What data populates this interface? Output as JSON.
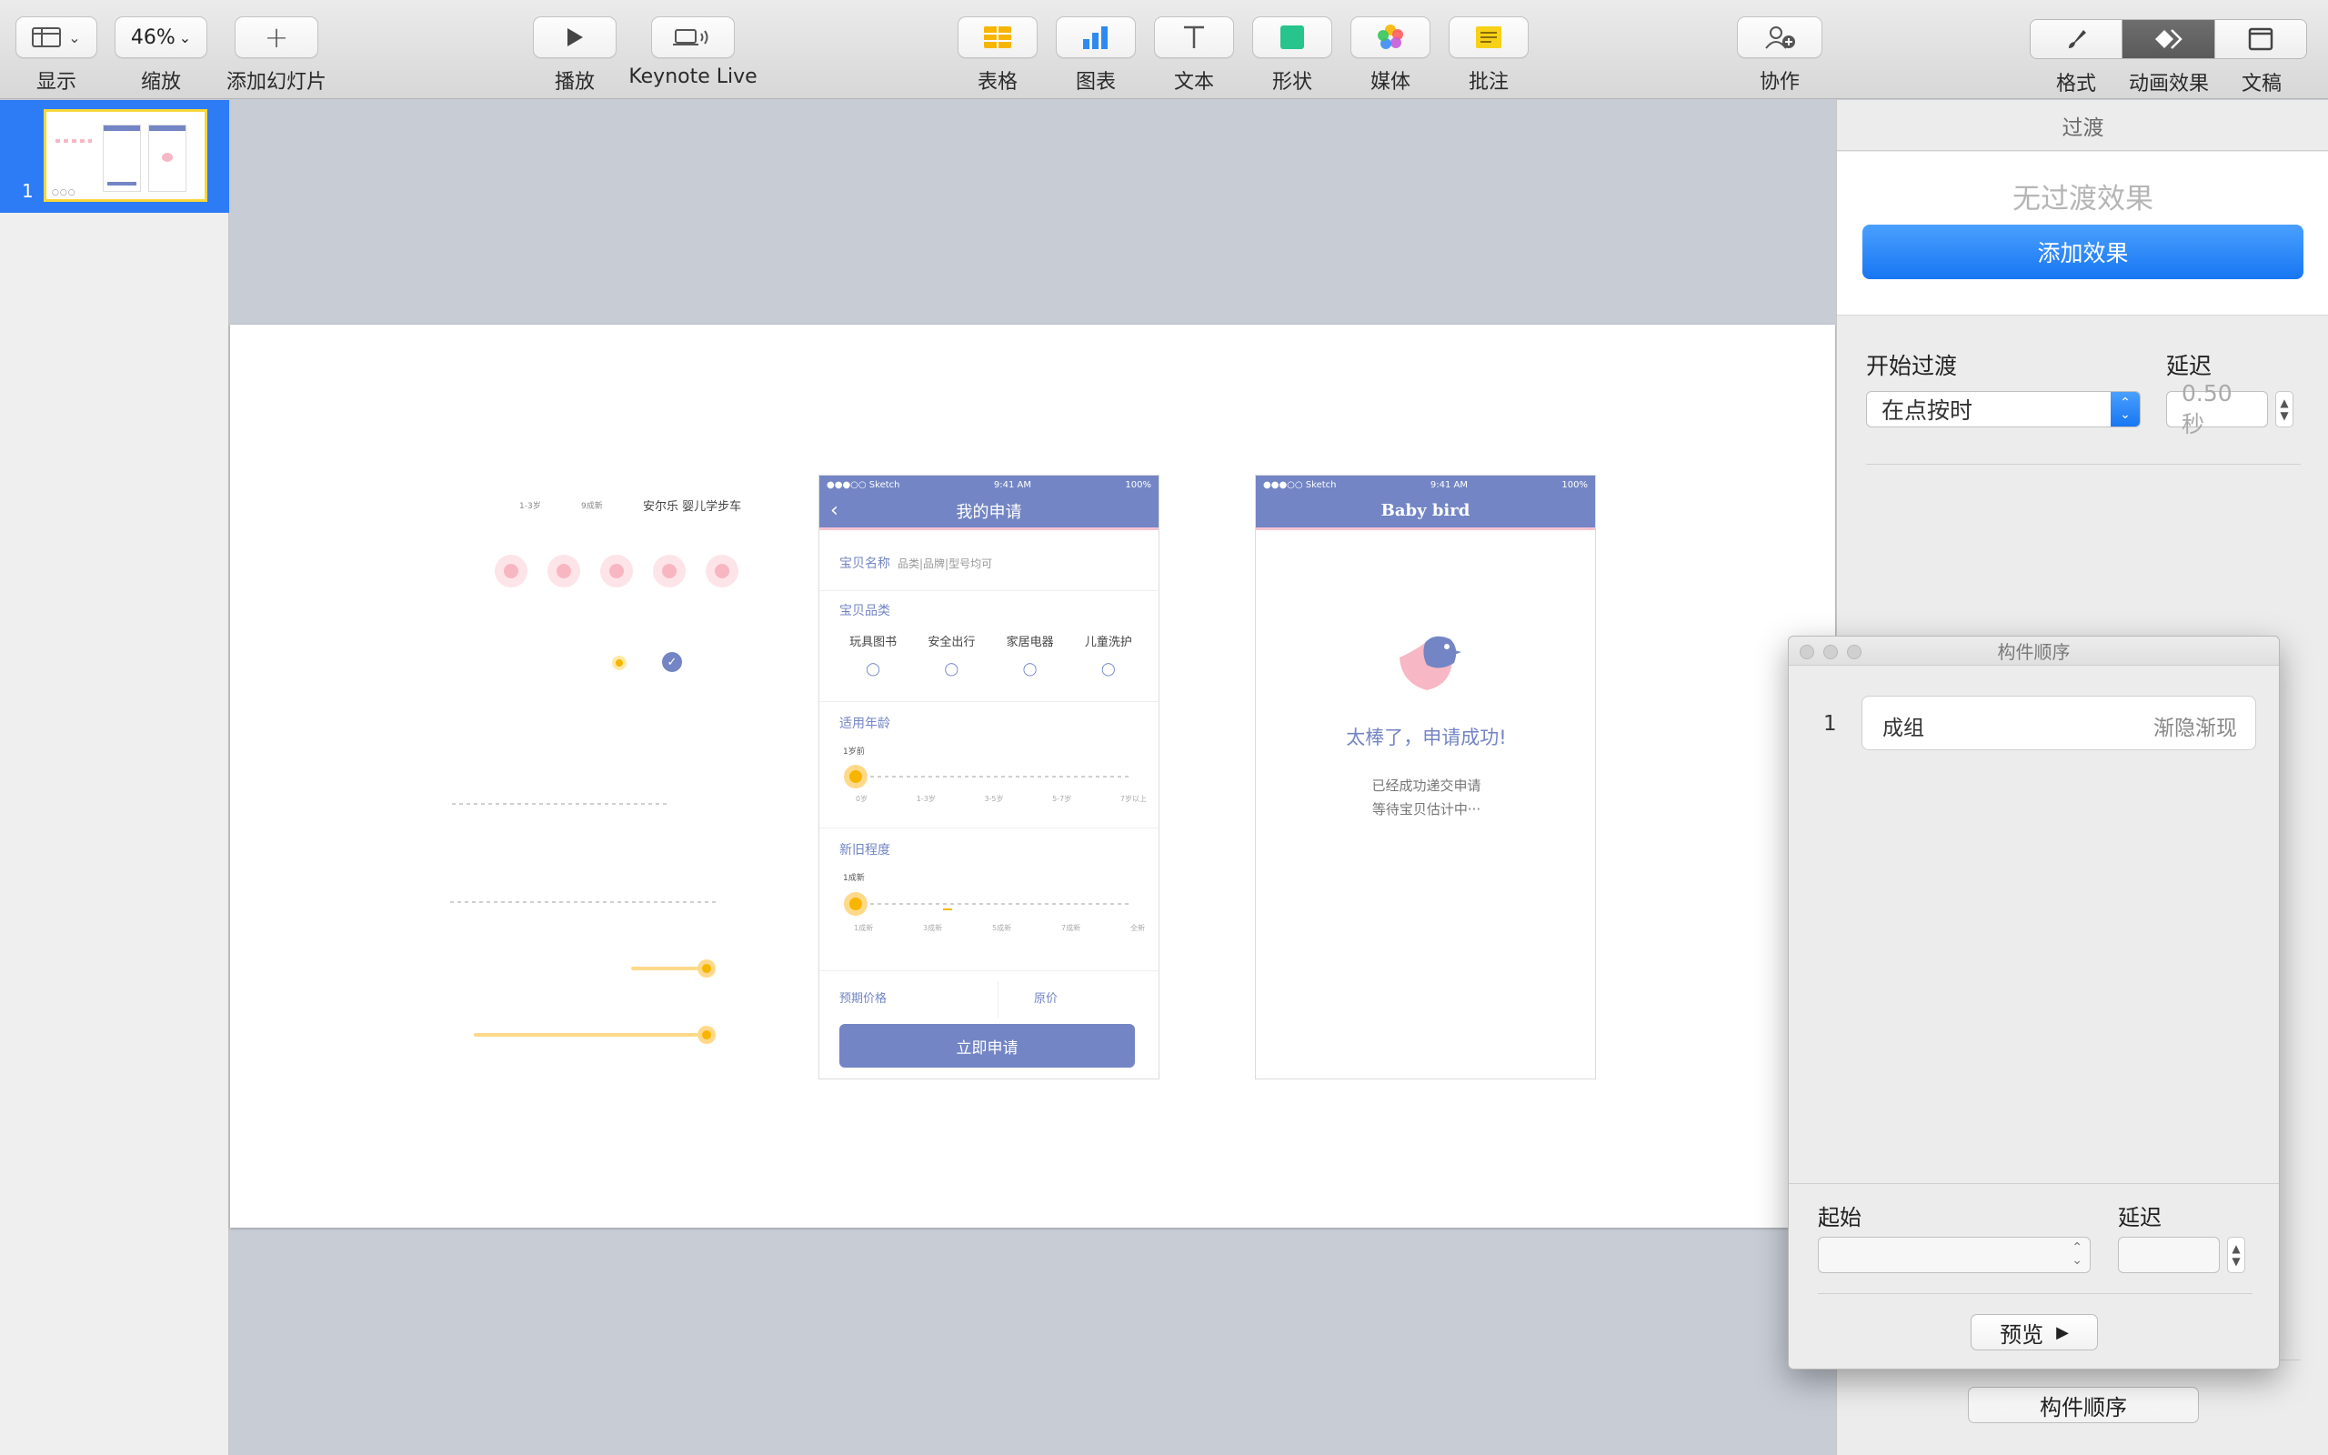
{
  "toolbar": {
    "view_label": "显示",
    "zoom_value": "46%",
    "zoom_label": "缩放",
    "add_slide_label": "添加幻灯片",
    "play_label": "播放",
    "keynote_live_label": "Keynote Live",
    "table_label": "表格",
    "chart_label": "图表",
    "text_label": "文本",
    "shape_label": "形状",
    "media_label": "媒体",
    "comment_label": "批注",
    "collaborate_label": "协作",
    "format_label": "格式",
    "animate_label": "动画效果",
    "document_label": "文稿",
    "accent_color": "#2d7cf6"
  },
  "navigator": {
    "slide_number": "1"
  },
  "slide": {
    "left_mock": {
      "age_label": "1-3岁",
      "condition_label": "9成新",
      "product_title": "安尔乐 婴儿学步车"
    },
    "phone1": {
      "carrier": "●●●○○ Sketch",
      "time": "9:41 AM",
      "battery": "100%",
      "title": "我的申请",
      "name_label": "宝贝名称",
      "name_placeholder": "品类|品牌|型号均可",
      "category_label": "宝贝品类",
      "categories": [
        "玩具图书",
        "安全出行",
        "家居电器",
        "儿童洗护"
      ],
      "age_label": "适用年龄",
      "age_selected": "1岁前",
      "age_ticks": [
        "0岁",
        "1-3岁",
        "3-5岁",
        "5-7岁",
        "7岁以上"
      ],
      "condition_label": "新旧程度",
      "condition_selected": "1成新",
      "condition_ticks": [
        "1成新",
        "3成新",
        "5成新",
        "7成新",
        "全新"
      ],
      "expected_price_label": "预期价格",
      "original_price_label": "原价",
      "apply_button": "立即申请",
      "brand_color": "#7385c4"
    },
    "phone2": {
      "carrier": "●●●○○ Sketch",
      "time": "9:41 AM",
      "battery": "100%",
      "title": "Baby bird",
      "success_title": "太棒了，申请成功!",
      "success_line1": "已经成功递交申请",
      "success_line2": "等待宝贝估计中···"
    }
  },
  "inspector": {
    "header": "过渡",
    "no_effect": "无过渡效果",
    "add_effect": "添加效果",
    "start_label": "开始过渡",
    "start_value": "在点按时",
    "delay_label": "延迟",
    "delay_value": "0.50 秒",
    "build_order_button": "构件顺序"
  },
  "build_order_panel": {
    "title": "构件顺序",
    "items": [
      {
        "index": "1",
        "name": "成组",
        "effect": "渐隐渐现"
      }
    ],
    "start_label": "起始",
    "delay_label": "延迟",
    "preview_button": "预览"
  }
}
